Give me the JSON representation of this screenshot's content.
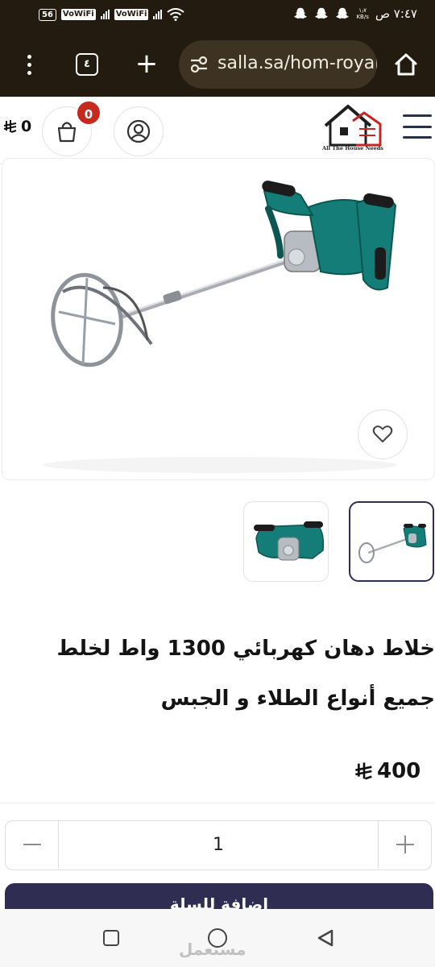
{
  "status_bar": {
    "time": "٧:٤٧ ص",
    "net_speed_value": "١٫٧",
    "net_speed_unit": "KB/s",
    "battery": "56",
    "sim1_label": "VoWiFi",
    "sim2_label": "VoWiFi",
    "icons": [
      "snapchat-ghost-icon",
      "snapchat-ghost-icon",
      "snapchat-ghost-icon",
      "wifi-icon",
      "signal-icon",
      "battery-icon"
    ]
  },
  "browser": {
    "tab_count": "٤",
    "new_tab_symbol": "+",
    "url": "salla.sa/hom-royal",
    "icons": [
      "menu-dots-icon",
      "tabs-icon",
      "plus-icon",
      "site-settings-icon",
      "home-icon"
    ]
  },
  "store_header": {
    "cart_total": "0",
    "cart_badge": "0",
    "logo_caption": "All The House Needs",
    "icons": [
      "riyal-currency-icon",
      "shopping-bag-icon",
      "user-account-icon",
      "hamburger-menu-icon"
    ]
  },
  "product": {
    "title": "خلاط دهان كهربائي 1300 واط لخلط جميع أنواع الطلاء و الجبس",
    "price": "400",
    "images": [
      "electric-paint-mixer-full",
      "electric-paint-mixer-closeup"
    ],
    "wishlist_icon": "heart-icon"
  },
  "quantity": {
    "value": "1",
    "minus_icon": "minus-icon",
    "plus_icon": "plus-icon"
  },
  "actions": {
    "add_to_cart_label": "إضافة للسلة"
  },
  "nav_bar": {
    "watermark": "مستعمل",
    "icons": [
      "recent-apps-icon",
      "home-circle-icon",
      "back-triangle-icon"
    ]
  },
  "colors": {
    "browser_chrome": "#231b0f",
    "brand_primary": "#2f2d52",
    "badge": "#c62a1f",
    "tool_teal": "#147d78"
  }
}
